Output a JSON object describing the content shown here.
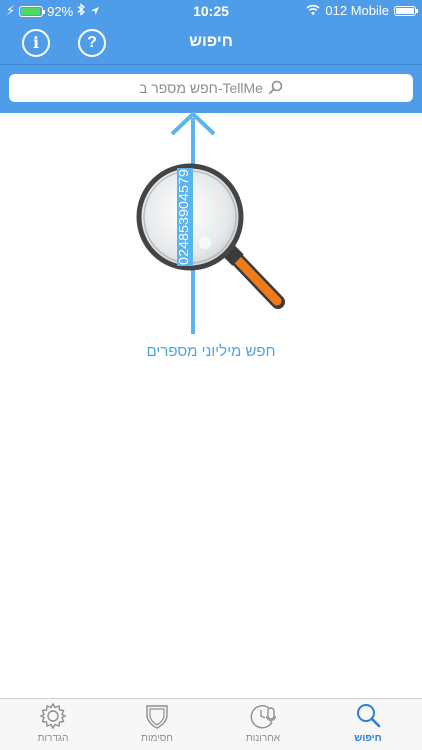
{
  "status_bar": {
    "battery_percent": "92%",
    "time": "10:25",
    "carrier": "012 Mobile"
  },
  "nav": {
    "title": "חיפוש",
    "info_label": "i",
    "help_label": "?"
  },
  "search": {
    "placeholder": "חפש מספר ב-TellMe"
  },
  "illustration": {
    "number_strip": "024853904579",
    "promo_text": "חפש מיליוני מספרים"
  },
  "tabs": [
    {
      "label": "הגדרות",
      "icon": "gear-icon"
    },
    {
      "label": "חסימות",
      "icon": "shield-icon"
    },
    {
      "label": "אחרונות",
      "icon": "clock-mic-icon"
    },
    {
      "label": "חיפוש",
      "icon": "magnifier-icon",
      "active": true
    }
  ],
  "colors": {
    "header": "#4f9ce8",
    "accent": "#4aa7e6",
    "active_tab": "#2a7fd8",
    "handle": "#f07a1a"
  }
}
